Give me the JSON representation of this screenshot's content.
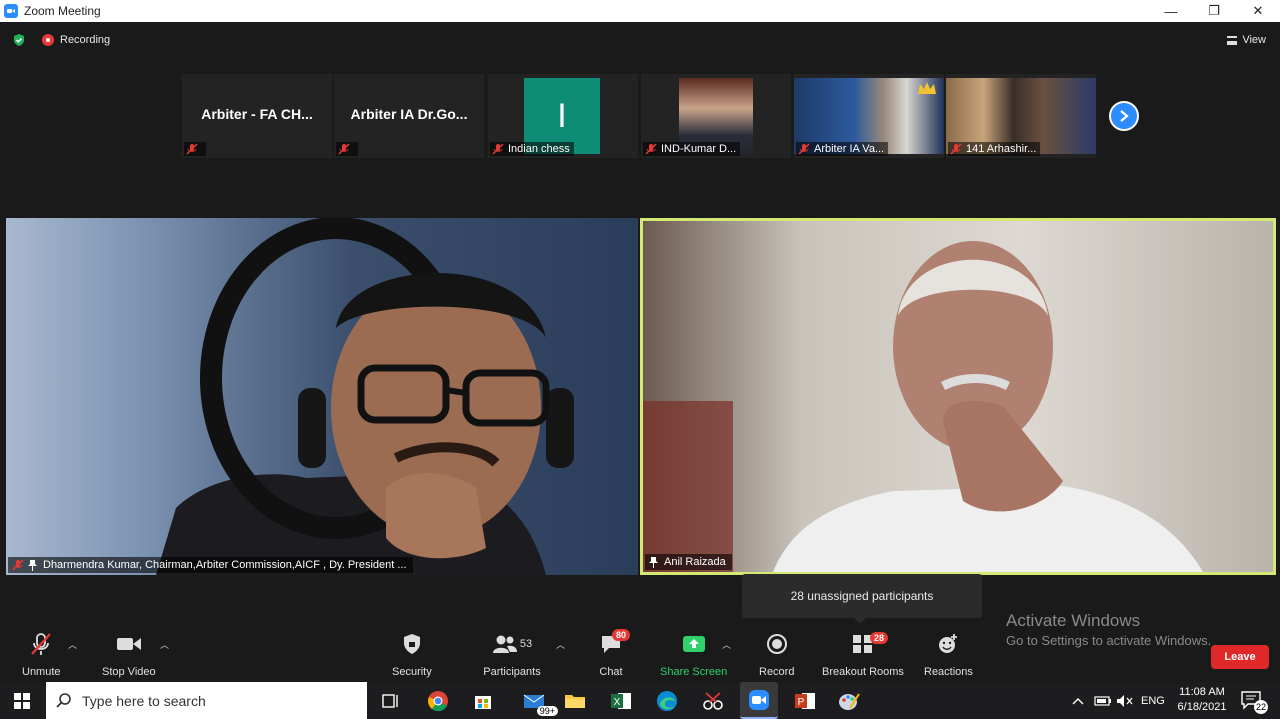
{
  "window": {
    "title": "Zoom Meeting",
    "minimize": "—",
    "restore": "❐",
    "close": "✕"
  },
  "topbar": {
    "recording": "Recording",
    "view": "View"
  },
  "thumbnails": [
    {
      "name": "Arbiter - FA CH...",
      "label": ""
    },
    {
      "name": "Arbiter IA Dr.Go...",
      "label": ""
    },
    {
      "initial": "I",
      "label": "Indian chess"
    },
    {
      "label": "IND-Kumar D..."
    },
    {
      "label": "Arbiter IA Va..."
    },
    {
      "label": "141 Arhashir..."
    }
  ],
  "tiles": [
    {
      "name": "Dharmendra Kumar, Chairman,Arbiter Commission,AICF , Dy. President ..."
    },
    {
      "name": "Anil Raizada"
    }
  ],
  "tooltip": "28 unassigned participants",
  "watermark": {
    "line1": "Activate Windows",
    "line2": "Go to Settings to activate Windows."
  },
  "toolbar": {
    "unmute": "Unmute",
    "stop_video": "Stop Video",
    "security": "Security",
    "participants": "Participants",
    "participants_count": "53",
    "chat": "Chat",
    "chat_badge": "80",
    "share_screen": "Share Screen",
    "record": "Record",
    "breakout": "Breakout Rooms",
    "breakout_badge": "28",
    "reactions": "Reactions",
    "leave": "Leave"
  },
  "taskbar": {
    "search_placeholder": "Type here to search",
    "mail_badge": "99+",
    "lang": "ENG",
    "time": "11:08 AM",
    "date": "6/18/2021",
    "notifications": "22"
  },
  "colors": {
    "accent": "#2d8cff",
    "leave": "#e02828",
    "active_speaker": "#d6e874",
    "share": "#2fd16b"
  }
}
